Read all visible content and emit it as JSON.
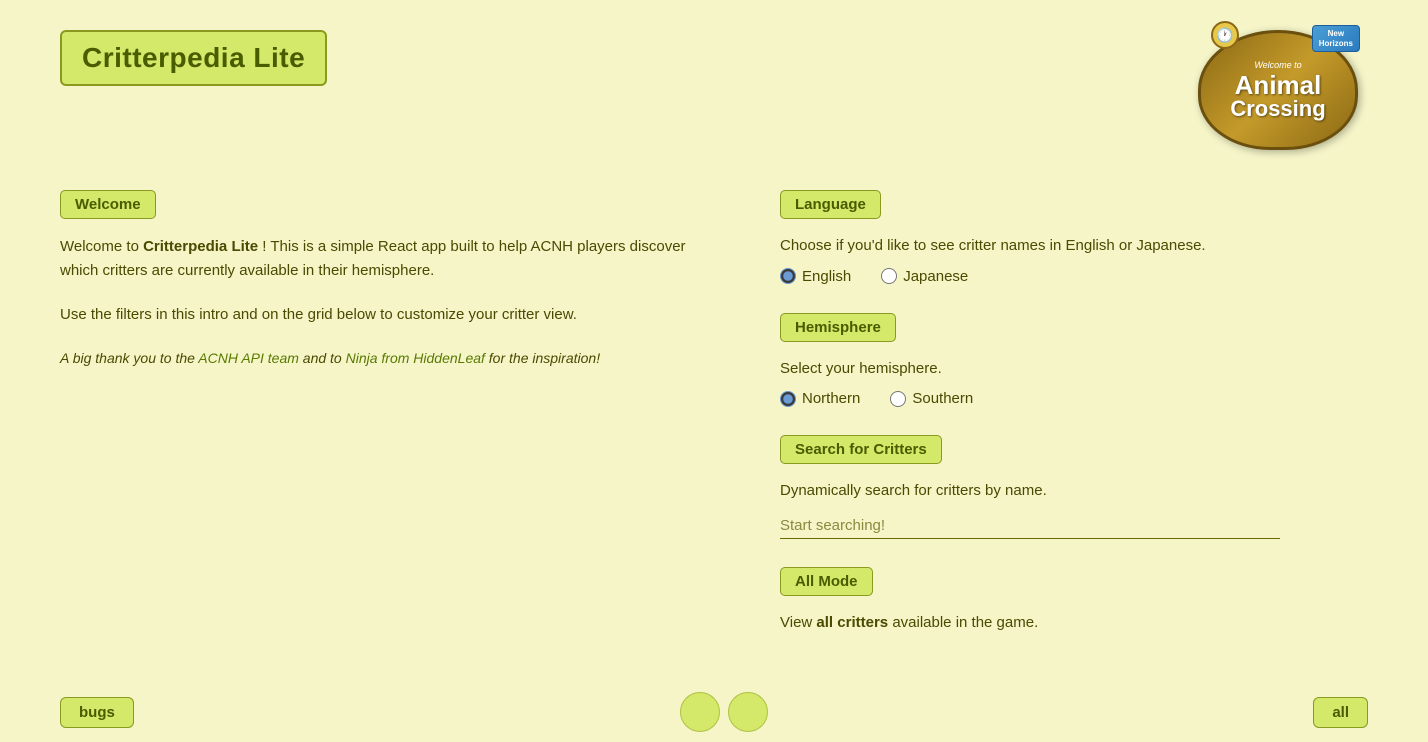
{
  "header": {
    "title": "Critterpedia Lite",
    "logo": {
      "welcome_text": "Welcome to",
      "animal": "Animal",
      "crossing": "Crossing",
      "badge": "New\nHorizons",
      "icon": "🕐"
    }
  },
  "left_panel": {
    "welcome_badge": "Welcome",
    "welcome_paragraph1_plain": "Welcome to ",
    "welcome_paragraph1_bold": "Critterpedia Lite",
    "welcome_paragraph1_rest": "! This is a simple React app built to help ACNH players discover which critters are currently available in their hemisphere.",
    "welcome_paragraph2": "Use the filters in this intro and on the grid below to customize your critter view.",
    "thank_you": "A big thank you to the ACNH API team and to Ninja from HiddenLeaf for the inspiration!"
  },
  "right_panel": {
    "language_badge": "Language",
    "language_description": "Choose if you'd like to see critter names in English or Japanese.",
    "language_options": [
      {
        "id": "english",
        "label": "English",
        "checked": true
      },
      {
        "id": "japanese",
        "label": "Japanese",
        "checked": false
      }
    ],
    "hemisphere_badge": "Hemisphere",
    "hemisphere_description": "Select your hemisphere.",
    "hemisphere_options": [
      {
        "id": "northern",
        "label": "Northern",
        "checked": true
      },
      {
        "id": "southern",
        "label": "Southern",
        "checked": false
      }
    ],
    "search_badge": "Search for Critters",
    "search_description": "Dynamically search for critters by name.",
    "search_placeholder": "Start searching!",
    "all_mode_badge": "All Mode",
    "all_mode_description_plain": "View ",
    "all_mode_description_bold": "all critters",
    "all_mode_description_rest": " available in the game."
  },
  "bottom_bar": {
    "left_button": "bugs",
    "right_button": "all"
  }
}
